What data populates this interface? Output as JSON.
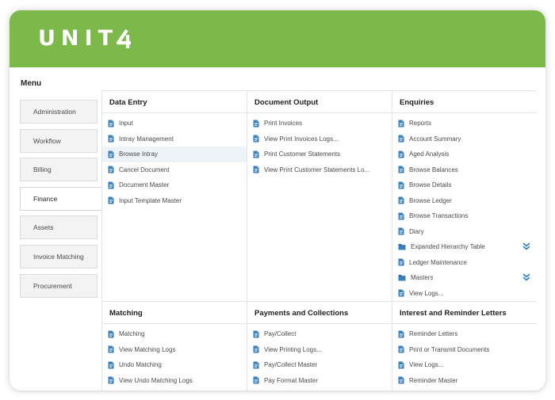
{
  "brand": {
    "logo_text": "UNIT",
    "logo_suffix": "4",
    "color": "#7cb94a"
  },
  "menu_title": "Menu",
  "sidebar": {
    "items": [
      {
        "label": "Administration",
        "active": false
      },
      {
        "label": "Workflow",
        "active": false
      },
      {
        "label": "Billing",
        "active": false
      },
      {
        "label": "Finance",
        "active": true
      },
      {
        "label": "Assets",
        "active": false
      },
      {
        "label": "Invoice Matching",
        "active": false
      },
      {
        "label": "Procurement",
        "active": false
      }
    ]
  },
  "sections": [
    {
      "title": "Data Entry",
      "items": [
        {
          "label": "Input",
          "icon": "document-icon"
        },
        {
          "label": "Intray Management",
          "icon": "document-icon"
        },
        {
          "label": "Browse Intray",
          "icon": "document-icon",
          "highlighted": true
        },
        {
          "label": "Cancel Document",
          "icon": "document-icon"
        },
        {
          "label": "Document Master",
          "icon": "document-icon"
        },
        {
          "label": "Input Template Master",
          "icon": "document-icon"
        }
      ]
    },
    {
      "title": "Document Output",
      "items": [
        {
          "label": "Print Invoices",
          "icon": "document-icon"
        },
        {
          "label": "View Print Invoices Logs...",
          "icon": "document-icon"
        },
        {
          "label": "Print Customer Statements",
          "icon": "document-icon"
        },
        {
          "label": "View Print Customer Statements Lo...",
          "icon": "document-icon"
        }
      ]
    },
    {
      "title": "Enquiries",
      "items": [
        {
          "label": "Reports",
          "icon": "document-icon"
        },
        {
          "label": "Account Summary",
          "icon": "document-icon"
        },
        {
          "label": "Aged Analysis",
          "icon": "document-icon"
        },
        {
          "label": "Browse Balances",
          "icon": "document-icon"
        },
        {
          "label": "Browse Details",
          "icon": "document-icon"
        },
        {
          "label": "Browse Ledger",
          "icon": "document-icon"
        },
        {
          "label": "Browse Transactions",
          "icon": "document-icon"
        },
        {
          "label": "Diary",
          "icon": "document-icon"
        },
        {
          "label": "Expanded Hierarchy Table",
          "icon": "folder-icon",
          "expandable": true
        },
        {
          "label": "Ledger Maintenance",
          "icon": "document-icon"
        },
        {
          "label": "Masters",
          "icon": "folder-icon",
          "expandable": true
        },
        {
          "label": "View Logs...",
          "icon": "document-icon"
        }
      ]
    },
    {
      "title": "Matching",
      "items": [
        {
          "label": "Matching",
          "icon": "document-icon"
        },
        {
          "label": "View Matching Logs",
          "icon": "document-icon"
        },
        {
          "label": "Undo Matching",
          "icon": "document-icon"
        },
        {
          "label": "View Undo Matching Logs",
          "icon": "document-icon"
        }
      ]
    },
    {
      "title": "Payments and Collections",
      "items": [
        {
          "label": "Pay/Collect",
          "icon": "document-icon"
        },
        {
          "label": "View Printing Logs...",
          "icon": "document-icon"
        },
        {
          "label": "Pay/Collect Master",
          "icon": "document-icon"
        },
        {
          "label": "Pay Format Master",
          "icon": "document-icon"
        }
      ]
    },
    {
      "title": "Interest and Reminder Letters",
      "items": [
        {
          "label": "Reminder Letters",
          "icon": "document-icon"
        },
        {
          "label": "Print or Transmit Documents",
          "icon": "document-icon"
        },
        {
          "label": "View Logs...",
          "icon": "document-icon"
        },
        {
          "label": "Reminder Master",
          "icon": "document-icon"
        }
      ]
    }
  ],
  "colors": {
    "icon": "#3a7fc0",
    "expand": "#2e7bbf",
    "highlight": "#eef3f8"
  }
}
